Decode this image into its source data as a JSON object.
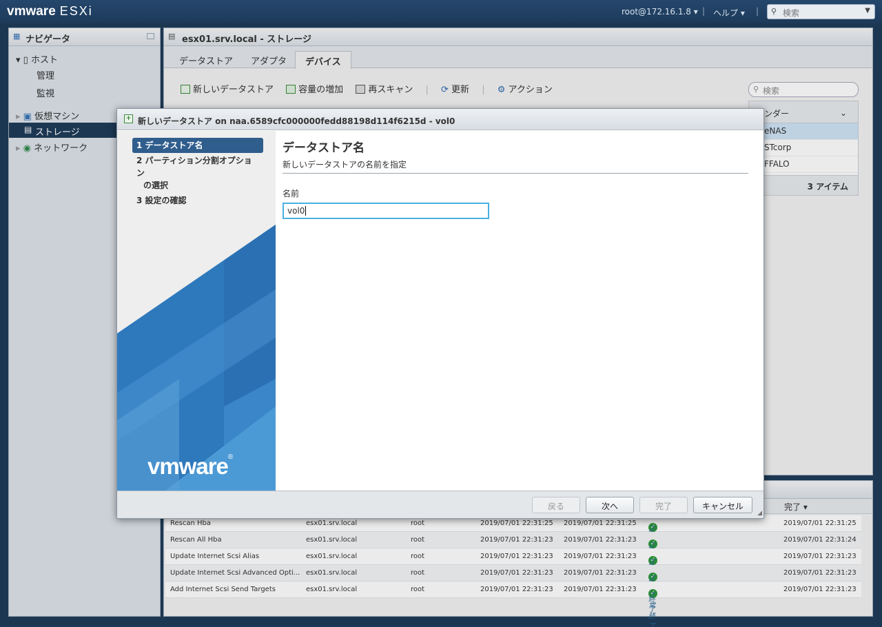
{
  "topbar": {
    "logo": "vmware",
    "product": "ESXi",
    "user": "root@172.16.1.8 ▾",
    "help": "ヘルプ ▾",
    "search_placeholder": "検索"
  },
  "navigator": {
    "title": "ナビゲータ",
    "host": "ホスト",
    "manage": "管理",
    "monitor": "監視",
    "vms": "仮想マシン",
    "storage": "ストレージ",
    "network": "ネットワーク"
  },
  "main": {
    "title": "esx01.srv.local - ストレージ",
    "tabs": [
      "データストア",
      "アダプタ",
      "デバイス"
    ],
    "toolbar": {
      "new_datastore": "新しいデータストア",
      "increase": "容量の増加",
      "rescan": "再スキャン",
      "refresh": "更新",
      "actions": "アクション"
    },
    "search_placeholder": "検索",
    "vendor_col": "ンダー",
    "vendors": [
      "eNAS",
      "STcorp",
      "FFALO"
    ],
    "item_count": "3 アイテム"
  },
  "tasks": {
    "complete_col": "完了 ▾",
    "rows": [
      {
        "task": "Rescan Hba",
        "target": "esx01.srv.local",
        "user": "root",
        "queued": "2019/07/01 22:31:25",
        "started": "2019/07/01 22:31:25",
        "result": "正常終了",
        "completed": "2019/07/01 22:31:25"
      },
      {
        "task": "Rescan All Hba",
        "target": "esx01.srv.local",
        "user": "root",
        "queued": "2019/07/01 22:31:23",
        "started": "2019/07/01 22:31:23",
        "result": "正常終了",
        "completed": "2019/07/01 22:31:24"
      },
      {
        "task": "Update Internet Scsi Alias",
        "target": "esx01.srv.local",
        "user": "root",
        "queued": "2019/07/01 22:31:23",
        "started": "2019/07/01 22:31:23",
        "result": "正常終了",
        "completed": "2019/07/01 22:31:23"
      },
      {
        "task": "Update Internet Scsi Advanced Opti...",
        "target": "esx01.srv.local",
        "user": "root",
        "queued": "2019/07/01 22:31:23",
        "started": "2019/07/01 22:31:23",
        "result": "正常終了",
        "completed": "2019/07/01 22:31:23"
      },
      {
        "task": "Add Internet Scsi Send Targets",
        "target": "esx01.srv.local",
        "user": "root",
        "queued": "2019/07/01 22:31:23",
        "started": "2019/07/01 22:31:23",
        "result": "正常終了",
        "completed": "2019/07/01 22:31:23"
      }
    ]
  },
  "dialog": {
    "title": "新しいデータストア on naa.6589cfc000000fedd88198d114f6215d - vol0",
    "steps": {
      "s1": "1 データストア名",
      "s2a": "2 パーティション分割オプション",
      "s2b": "の選択",
      "s3": "3 設定の確認"
    },
    "brand": "vmware",
    "heading": "データストア名",
    "subheading": "新しいデータストアの名前を指定",
    "name_label": "名前",
    "name_value": "vol0",
    "buttons": {
      "back": "戻る",
      "next": "次へ",
      "finish": "完了",
      "cancel": "キャンセル"
    }
  },
  "colors": {
    "header": "#1f3c5a",
    "accent": "#2f5d8c",
    "focus": "#4ab0e0",
    "success": "#2e9a3a"
  }
}
